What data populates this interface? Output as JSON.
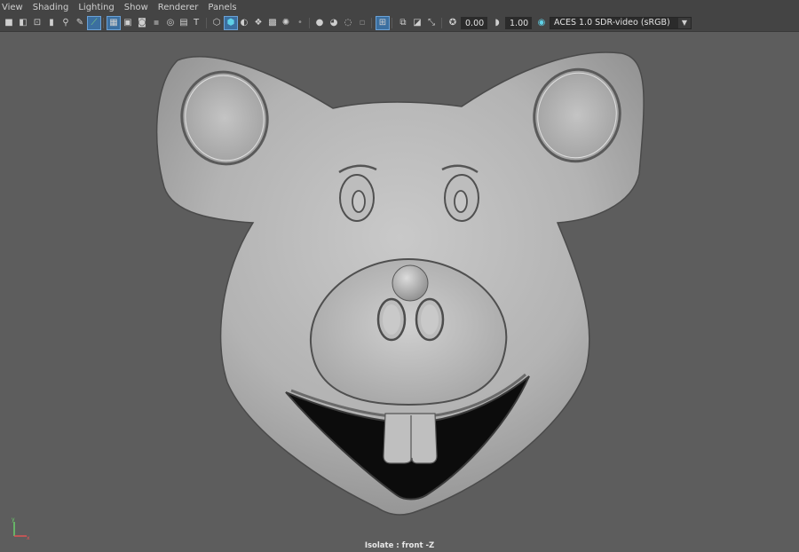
{
  "menu": {
    "items": [
      "View",
      "Shading",
      "Lighting",
      "Show",
      "Renderer",
      "Panels"
    ]
  },
  "toolbar": {
    "exposure_value": "0.00",
    "gamma_value": "1.00",
    "color_space": "ACES 1.0 SDR-video (sRGB)",
    "icons": [
      "select-camera-icon",
      "camera-attributes-icon",
      "bookmark-icon",
      "image-plane-icon",
      "2d-pan-zoom-icon",
      "grease-pencil-icon",
      "grid-icon",
      "film-gate-icon",
      "resolution-gate-icon",
      "gate-mask-icon",
      "field-chart-icon",
      "safe-action-icon",
      "safe-title-icon",
      "wireframe-icon",
      "smooth-shade-icon",
      "use-default-material-icon",
      "wireframe-on-shaded-icon",
      "textured-icon",
      "use-all-lights-icon",
      "shadows-icon",
      "screen-space-ao-icon",
      "motion-blur-icon",
      "anti-aliasing-icon",
      "depth-of-field-icon",
      "isolate-select-icon",
      "xray-icon",
      "xray-active-components-icon",
      "xray-joints-icon",
      "exposure-icon",
      "gamma-icon",
      "color-management-icon"
    ],
    "colors": {
      "bar": "#444444",
      "active": "#3b6fa0",
      "accent_green": "#7ed07e",
      "accent_cyan": "#5fd0e6"
    }
  },
  "viewport": {
    "background": "#5d5d5d",
    "camera_label": "Isolate : front -Z"
  },
  "axis": {
    "x": "x",
    "y": "y"
  }
}
